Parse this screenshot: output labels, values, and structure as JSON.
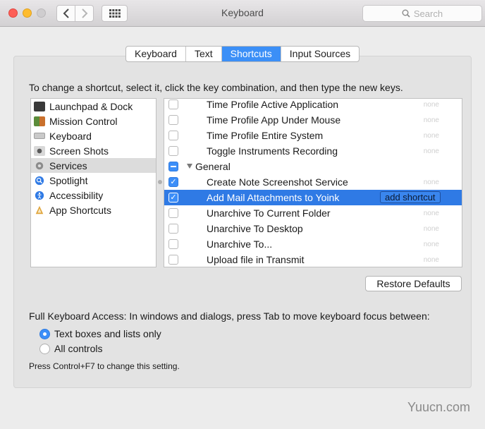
{
  "window": {
    "title": "Keyboard",
    "search_placeholder": "Search"
  },
  "tabs": [
    {
      "label": "Keyboard",
      "active": false
    },
    {
      "label": "Text",
      "active": false
    },
    {
      "label": "Shortcuts",
      "active": true
    },
    {
      "label": "Input Sources",
      "active": false
    }
  ],
  "instruction": "To change a shortcut, select it, click the key combination, and then type the new keys.",
  "categories": [
    {
      "label": "Launchpad & Dock",
      "icon": "launchpad-icon",
      "selected": false
    },
    {
      "label": "Mission Control",
      "icon": "mission-control-icon",
      "selected": false
    },
    {
      "label": "Keyboard",
      "icon": "keyboard-icon",
      "selected": false
    },
    {
      "label": "Screen Shots",
      "icon": "screenshot-icon",
      "selected": false
    },
    {
      "label": "Services",
      "icon": "gear-icon",
      "selected": true
    },
    {
      "label": "Spotlight",
      "icon": "spotlight-icon",
      "selected": false
    },
    {
      "label": "Accessibility",
      "icon": "accessibility-icon",
      "selected": false
    },
    {
      "label": "App Shortcuts",
      "icon": "app-shortcuts-icon",
      "selected": false
    }
  ],
  "shortcuts": [
    {
      "label": "Time Profile Active Application",
      "state": "unchecked",
      "value": "none"
    },
    {
      "label": "Time Profile App Under Mouse",
      "state": "unchecked",
      "value": "none"
    },
    {
      "label": "Time Profile Entire System",
      "state": "unchecked",
      "value": "none"
    },
    {
      "label": "Toggle Instruments Recording",
      "state": "unchecked",
      "value": "none"
    },
    {
      "label": "General",
      "state": "mixed",
      "group": true
    },
    {
      "label": "Create Note Screenshot Service",
      "state": "checked",
      "value": "none"
    },
    {
      "label": "Add Mail Attachments to Yoink",
      "state": "checked",
      "selected": true,
      "button": "add shortcut"
    },
    {
      "label": "Unarchive To Current Folder",
      "state": "unchecked",
      "value": "none"
    },
    {
      "label": "Unarchive To Desktop",
      "state": "unchecked",
      "value": "none"
    },
    {
      "label": "Unarchive To...",
      "state": "unchecked",
      "value": "none"
    },
    {
      "label": "Upload file in Transmit",
      "state": "unchecked",
      "value": "none"
    }
  ],
  "restore_defaults": "Restore Defaults",
  "full_keyboard_access": {
    "label": "Full Keyboard Access: In windows and dialogs, press Tab to move keyboard focus between:",
    "options": [
      {
        "label": "Text boxes and lists only",
        "selected": true
      },
      {
        "label": "All controls",
        "selected": false
      }
    ],
    "hint": "Press Control+F7 to change this setting."
  },
  "watermark": "Yuucn.com",
  "colors": {
    "accent": "#3b8ff7",
    "selection": "#2f7ae5"
  }
}
